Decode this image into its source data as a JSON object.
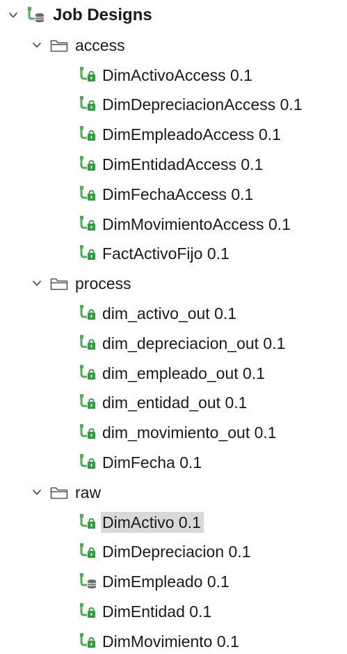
{
  "tree": {
    "root": {
      "label": "Job Designs",
      "icon": "job-designs-db-icon",
      "expanded": true
    },
    "folders": [
      {
        "label": "access",
        "icon": "folder-icon",
        "expanded": true,
        "items": [
          {
            "label": "DimActivoAccess 0.1",
            "icon": "job-locked-icon"
          },
          {
            "label": "DimDepreciacionAccess 0.1",
            "icon": "job-locked-icon"
          },
          {
            "label": "DimEmpleadoAccess 0.1",
            "icon": "job-locked-icon"
          },
          {
            "label": "DimEntidadAccess 0.1",
            "icon": "job-locked-icon"
          },
          {
            "label": "DimFechaAccess 0.1",
            "icon": "job-locked-icon"
          },
          {
            "label": "DimMovimientoAccess 0.1",
            "icon": "job-locked-icon"
          },
          {
            "label": "FactActivoFijo 0.1",
            "icon": "job-locked-icon"
          }
        ]
      },
      {
        "label": "process",
        "icon": "folder-icon",
        "expanded": true,
        "items": [
          {
            "label": "dim_activo_out 0.1",
            "icon": "job-locked-icon"
          },
          {
            "label": "dim_depreciacion_out 0.1",
            "icon": "job-locked-icon"
          },
          {
            "label": "dim_empleado_out 0.1",
            "icon": "job-locked-icon"
          },
          {
            "label": "dim_entidad_out 0.1",
            "icon": "job-locked-icon"
          },
          {
            "label": "dim_movimiento_out 0.1",
            "icon": "job-locked-icon"
          },
          {
            "label": "DimFecha 0.1",
            "icon": "job-locked-icon"
          }
        ]
      },
      {
        "label": "raw",
        "icon": "folder-icon",
        "expanded": true,
        "items": [
          {
            "label": "DimActivo 0.1",
            "icon": "job-locked-icon",
            "selected": true
          },
          {
            "label": "DimDepreciacion 0.1",
            "icon": "job-locked-icon"
          },
          {
            "label": "DimEmpleado 0.1",
            "icon": "job-db-icon"
          },
          {
            "label": "DimEntidad 0.1",
            "icon": "job-locked-icon"
          },
          {
            "label": "DimMovimiento 0.1",
            "icon": "job-locked-icon"
          }
        ]
      }
    ]
  },
  "colors": {
    "icon_green": "#4caf50",
    "lock_green": "#2e9e3e",
    "db_gray": "#6e6e6e",
    "selection": "#d9d9d9"
  }
}
